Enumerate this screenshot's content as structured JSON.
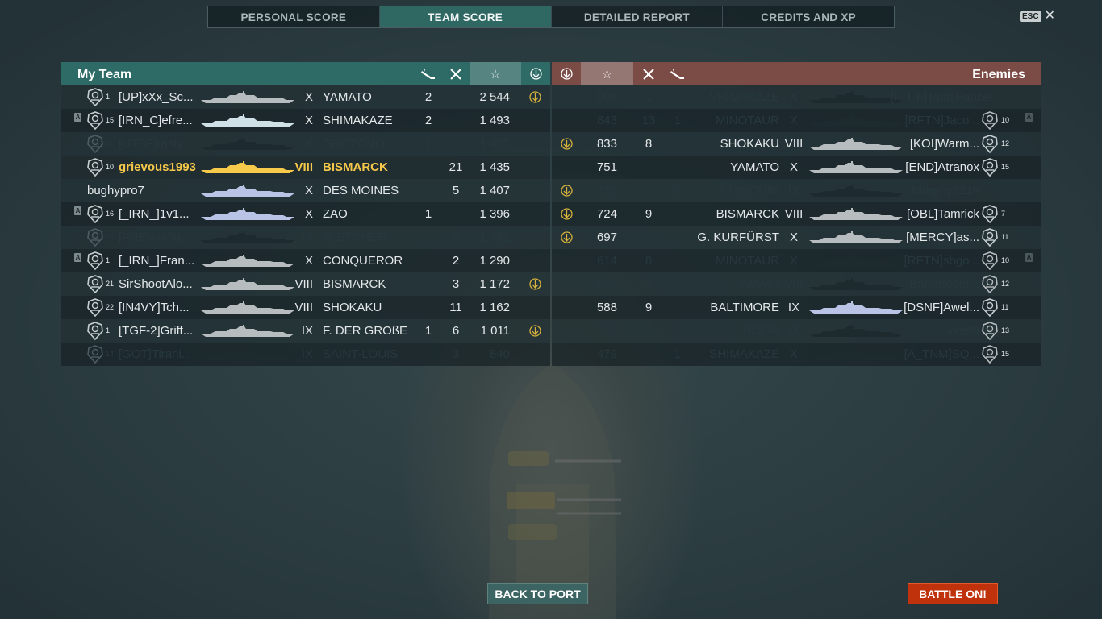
{
  "tabs": [
    {
      "label": "PERSONAL SCORE",
      "active": false
    },
    {
      "label": "TEAM SCORE",
      "active": true
    },
    {
      "label": "DETAILED REPORT",
      "active": false
    },
    {
      "label": "CREDITS AND XP",
      "active": false
    }
  ],
  "esc_label": "ESC",
  "colors": {
    "my_team_header": "#2e6b66",
    "enemy_header": "#7b4b45",
    "highlight_player": "#f6c94a",
    "battle_button": "#c0320c"
  },
  "my_team": {
    "title": "My Team",
    "columns": [
      "torpedo-icon",
      "plane-icon",
      "star-icon",
      "ribbon-icon"
    ],
    "rows": [
      {
        "badge": "",
        "rank": "1",
        "name": "[UP]xXx_Sc...",
        "tier": "X",
        "ship": "YAMATO",
        "torpedo": "2",
        "planes": "",
        "score": "2 544",
        "award": true,
        "alive": true,
        "me": false
      },
      {
        "badge": "A",
        "rank": "15",
        "name": "[IRN_C]efre...",
        "tier": "X",
        "ship": "SHIMAKAZE",
        "torpedo": "2",
        "planes": "",
        "score": "1 493",
        "award": false,
        "alive": true,
        "me": false
      },
      {
        "badge": "",
        "rank": "11",
        "name": "[UTBF]rasty...",
        "tier": "X",
        "ship": "GROZOVOI",
        "torpedo": "1",
        "planes": "",
        "score": "1 455",
        "award": false,
        "alive": false,
        "me": false
      },
      {
        "badge": "",
        "rank": "10",
        "name": "grievous1993",
        "tier": "VIII",
        "ship": "BISMARCK",
        "torpedo": "",
        "planes": "21",
        "score": "1 435",
        "award": false,
        "alive": true,
        "me": true
      },
      {
        "badge": "",
        "rank": "",
        "name": "bughypro7",
        "tier": "X",
        "ship": "DES MOINES",
        "torpedo": "",
        "planes": "5",
        "score": "1 407",
        "award": false,
        "alive": true,
        "me": false
      },
      {
        "badge": "A",
        "rank": "16",
        "name": "[_IRN_]1v1...",
        "tier": "X",
        "ship": "ZAO",
        "torpedo": "1",
        "planes": "",
        "score": "1 396",
        "award": false,
        "alive": true,
        "me": false
      },
      {
        "badge": "",
        "rank": "15",
        "name": "[FNE]skyfig...",
        "tier": "IX",
        "ship": "FLETCHER",
        "torpedo": "",
        "planes": "2",
        "score": "1 382",
        "award": false,
        "alive": false,
        "me": false
      },
      {
        "badge": "A",
        "rank": "1",
        "name": "[_IRN_]Fran...",
        "tier": "X",
        "ship": "CONQUEROR",
        "torpedo": "",
        "planes": "2",
        "score": "1 290",
        "award": false,
        "alive": true,
        "me": false
      },
      {
        "badge": "",
        "rank": "21",
        "name": "SirShootAlo...",
        "tier": "VIII",
        "ship": "BISMARCK",
        "torpedo": "",
        "planes": "3",
        "score": "1 172",
        "award": true,
        "alive": true,
        "me": false
      },
      {
        "badge": "",
        "rank": "22",
        "name": "[IN4VY]Tch...",
        "tier": "VIII",
        "ship": "SHOKAKU",
        "torpedo": "",
        "planes": "11",
        "score": "1 162",
        "award": false,
        "alive": true,
        "me": false
      },
      {
        "badge": "",
        "rank": "1",
        "name": "[TGF-2]Griff...",
        "tier": "IX",
        "ship": "F. DER GROßE",
        "torpedo": "1",
        "planes": "6",
        "score": "1 011",
        "award": true,
        "alive": true,
        "me": false
      },
      {
        "badge": "",
        "rank": "14",
        "name": "[GOT]Tirani...",
        "tier": "IX",
        "ship": "SAINT-LOUIS",
        "torpedo": "",
        "planes": "3",
        "score": "840",
        "award": false,
        "alive": false,
        "me": false
      }
    ]
  },
  "enemies": {
    "title": "Enemies",
    "columns": [
      "ribbon-icon",
      "star-icon",
      "plane-icon",
      "torpedo-icon"
    ],
    "rows": [
      {
        "badge": "",
        "rank": "",
        "name": "[F-T-F]TottisPanzer",
        "tier": "X",
        "ship": "SHIMAKAZE",
        "torpedo": "",
        "planes": "1",
        "score": "906",
        "award": false,
        "alive": false
      },
      {
        "badge": "A",
        "rank": "10",
        "name": "[RFTN]Jaco...",
        "tier": "X",
        "ship": "MINOTAUR",
        "torpedo": "1",
        "planes": "13",
        "score": "843",
        "award": false,
        "alive": false
      },
      {
        "badge": "",
        "rank": "12",
        "name": "[KOI]Warm...",
        "tier": "VIII",
        "ship": "SHOKAKU",
        "torpedo": "",
        "planes": "8",
        "score": "833",
        "award": true,
        "alive": true
      },
      {
        "badge": "",
        "rank": "15",
        "name": "[END]Atranox",
        "tier": "X",
        "ship": "YAMATO",
        "torpedo": "",
        "planes": "",
        "score": "751",
        "award": false,
        "alive": true
      },
      {
        "badge": "",
        "rank": "",
        "name": "Murphy8219",
        "tier": "IX",
        "ship": "MISSOURI",
        "torpedo": "1",
        "planes": "",
        "score": "735",
        "award": true,
        "alive": false
      },
      {
        "badge": "",
        "rank": "7",
        "name": "[OBL]Tamrick",
        "tier": "VIII",
        "ship": "BISMARCK",
        "torpedo": "",
        "planes": "9",
        "score": "724",
        "award": true,
        "alive": true
      },
      {
        "badge": "",
        "rank": "11",
        "name": "[MERCY]as...",
        "tier": "X",
        "ship": "G. KURFÜRST",
        "torpedo": "",
        "planes": "",
        "score": "697",
        "award": true,
        "alive": true
      },
      {
        "badge": "A",
        "rank": "10",
        "name": "[RFTN]sbgo...",
        "tier": "X",
        "ship": "MINOTAUR",
        "torpedo": "",
        "planes": "8",
        "score": "614",
        "award": false,
        "alive": false
      },
      {
        "badge": "",
        "rank": "12",
        "name": "BangBoom...",
        "tier": "VIII",
        "ship": "AMAGI",
        "torpedo": "",
        "planes": "1",
        "score": "607",
        "award": false,
        "alive": false
      },
      {
        "badge": "",
        "rank": "11",
        "name": "[DSNF]Awel...",
        "tier": "IX",
        "ship": "BALTIMORE",
        "torpedo": "",
        "planes": "9",
        "score": "588",
        "award": false,
        "alive": true
      },
      {
        "badge": "",
        "rank": "13",
        "name": "vxe99",
        "tier": "IX",
        "ship": "ROON",
        "torpedo": "",
        "planes": "",
        "score": "529",
        "award": false,
        "alive": false
      },
      {
        "badge": "",
        "rank": "15",
        "name": "[A_TNM]SQ...",
        "tier": "X",
        "ship": "SHIMAKAZE",
        "torpedo": "1",
        "planes": "",
        "score": "479",
        "award": false,
        "alive": false
      }
    ]
  },
  "buttons": {
    "back_to_port": "BACK TO PORT",
    "battle_on": "BATTLE ON!"
  }
}
